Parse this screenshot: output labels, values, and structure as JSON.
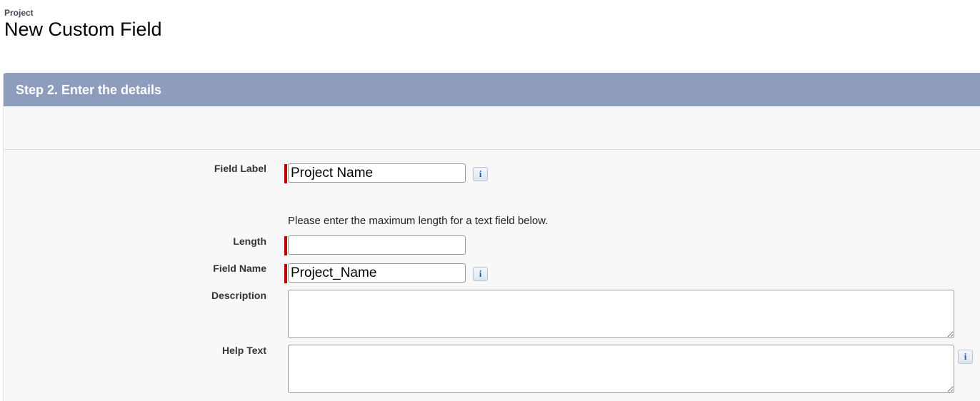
{
  "header": {
    "breadcrumb": "Project",
    "title": "New Custom Field"
  },
  "step": {
    "title": "Step 2. Enter the details"
  },
  "form": {
    "field_label": {
      "label": "Field Label",
      "value": "Project Name",
      "required": true,
      "info_icon": "info-icon"
    },
    "length_hint": "Please enter the maximum length for a text field below.",
    "length": {
      "label": "Length",
      "value": "",
      "required": true
    },
    "field_name": {
      "label": "Field Name",
      "value": "Project_Name",
      "required": true,
      "info_icon": "info-icon"
    },
    "description": {
      "label": "Description",
      "value": ""
    },
    "help_text": {
      "label": "Help Text",
      "value": "",
      "info_icon": "info-icon"
    }
  },
  "colors": {
    "step_header_bg": "#8e9dbe",
    "required_marker": "#c00000",
    "panel_bg": "#f8f8f8"
  }
}
